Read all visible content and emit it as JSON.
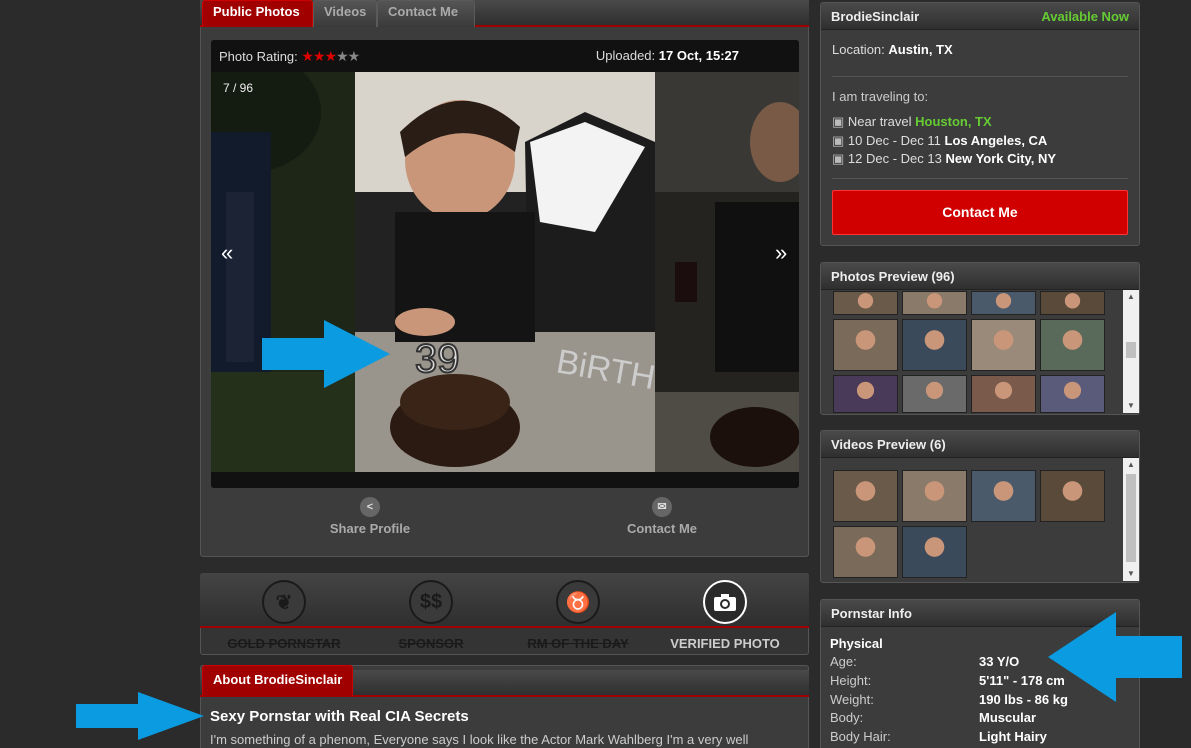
{
  "tabs": [
    {
      "label": "Public Photos",
      "active": true
    },
    {
      "label": "Videos",
      "active": false
    },
    {
      "label": "Contact Me",
      "active": false
    }
  ],
  "photo": {
    "rating_label": "Photo Rating:",
    "rating_value": 3,
    "rating_max": 5,
    "uploaded_label": "Uploaded:",
    "uploaded_value": "17 Oct, 15:27",
    "counter": "7 / 96",
    "prev": "«",
    "next": "»"
  },
  "actions": {
    "share": "Share Profile",
    "contact": "Contact Me"
  },
  "badges": [
    {
      "label": "GOLD PORNSTAR",
      "icon": "medal-icon",
      "active": false
    },
    {
      "label": "SPONSOR",
      "icon": "dollar-icon",
      "active": false
    },
    {
      "label": "RM OF THE DAY",
      "icon": "devil-icon",
      "active": false
    },
    {
      "label": "VERIFIED PHOTO",
      "icon": "camera-icon",
      "active": true
    }
  ],
  "about": {
    "tab": "About BrodieSinclair",
    "headline": "Sexy Pornstar with Real CIA Secrets",
    "text": "I'm something of a phenom, Everyone says I look like the Actor Mark Wahlberg I'm a very well"
  },
  "profile": {
    "name": "BrodieSinclair",
    "status": "Available Now",
    "location_label": "Location:",
    "location": "Austin, TX",
    "traveling_label": "I am traveling to:",
    "travel": [
      {
        "prefix": "Near travel",
        "place": "Houston, TX",
        "highlight": true
      },
      {
        "prefix": "10 Dec - Dec 11",
        "place": "Los Angeles, CA",
        "highlight": false
      },
      {
        "prefix": "12 Dec - Dec 13",
        "place": "New York City, NY",
        "highlight": false
      }
    ],
    "contact_button": "Contact Me"
  },
  "photos_preview": {
    "title": "Photos Preview (96)"
  },
  "videos_preview": {
    "title": "Videos Preview (6)"
  },
  "info": {
    "title": "Pornstar Info",
    "section": "Physical",
    "rows": [
      {
        "label": "Age:",
        "value": "33 Y/O"
      },
      {
        "label": "Height:",
        "value": "5'11\" - 178 cm"
      },
      {
        "label": "Weight:",
        "value": "190 lbs - 86 kg"
      },
      {
        "label": "Body:",
        "value": "Muscular"
      },
      {
        "label": "Body Hair:",
        "value": "Light Hairy"
      }
    ]
  },
  "colors": {
    "accent_red": "#a00000",
    "contact_red": "#d00000",
    "available_green": "#66cc33",
    "annotation_blue": "#0a9be0"
  }
}
